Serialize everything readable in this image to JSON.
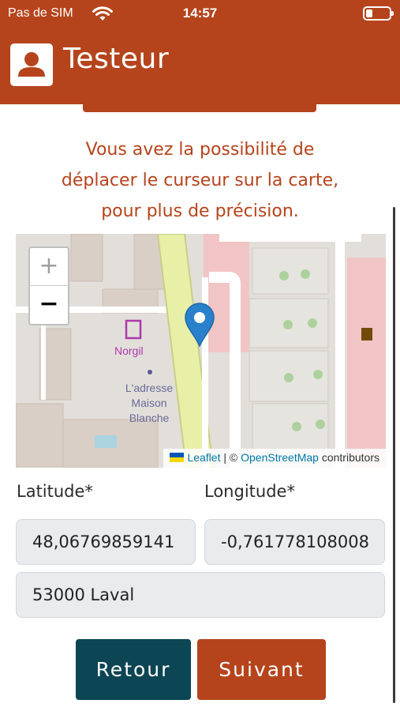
{
  "status_bar": {
    "carrier": "Pas de SIM",
    "time": "14:57",
    "wifi_icon": "wifi-icon",
    "battery_icon": "battery-icon"
  },
  "header": {
    "title": "Testeur",
    "avatar_icon": "user-avatar-icon",
    "color": "#b5441c"
  },
  "intro": {
    "line1": "Vous avez la possibilité de",
    "line2": "déplacer le curseur sur la carte,",
    "line3": "pour plus de précision."
  },
  "map": {
    "zoom_in": "+",
    "zoom_out": "−",
    "poi_name": "Norgil",
    "place_line1": "L'adresse",
    "place_line2": "Maison",
    "place_line3": "Blanche",
    "attribution_leaflet": "Leaflet",
    "attribution_sep": " | © ",
    "attribution_osm": "OpenStreetMap",
    "attribution_suffix": " contributors",
    "marker_icon": "map-marker-icon"
  },
  "form": {
    "latitude_label": "Latitude*",
    "longitude_label": "Longitude*",
    "latitude_value": "48,06769859141",
    "longitude_value": "-0,761778108008",
    "address_value": "53000 Laval"
  },
  "buttons": {
    "back": "Retour",
    "next": "Suivant",
    "back_color": "#0c4553",
    "next_color": "#b5441c"
  }
}
